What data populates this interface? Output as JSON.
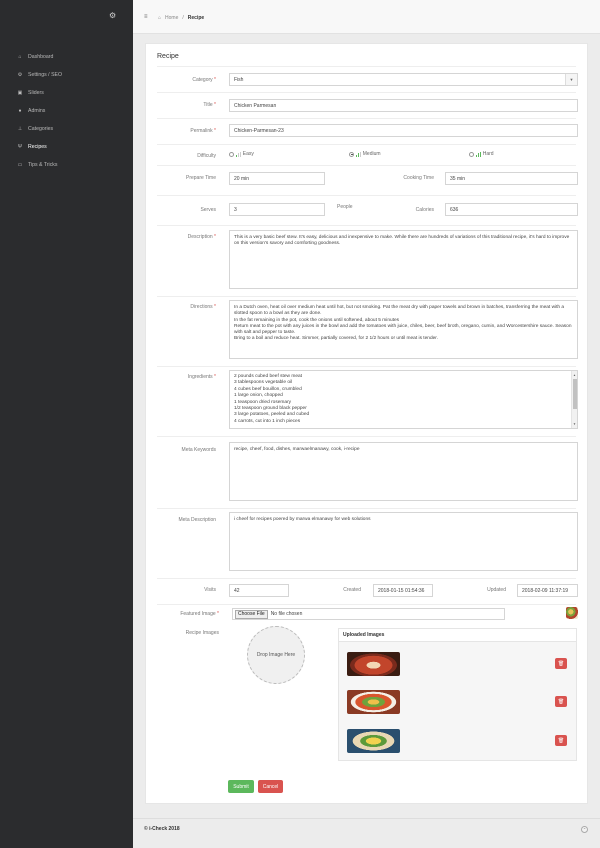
{
  "sidebar": {
    "items": [
      {
        "label": "Dashboard",
        "icon": "home-icon",
        "glyph": "⌂"
      },
      {
        "label": "Settings / SEO",
        "icon": "cogs-icon",
        "glyph": "⚙"
      },
      {
        "label": "Sliders",
        "icon": "image-icon",
        "glyph": "▣"
      },
      {
        "label": "Admins",
        "icon": "user-icon",
        "glyph": "●"
      },
      {
        "label": "Categories",
        "icon": "sitemap-icon",
        "glyph": "⊥"
      },
      {
        "label": "Recipes",
        "icon": "cutlery-icon",
        "glyph": "Ψ"
      },
      {
        "label": "Tips & Tricks",
        "icon": "card-icon",
        "glyph": "▭"
      }
    ]
  },
  "header": {
    "menu_glyph": "≡",
    "home_label": "Home",
    "separator": "/",
    "current": "Recipe"
  },
  "form": {
    "title": "Recipe",
    "labels": {
      "category": "Category",
      "title": "Title",
      "permalink": "Permalink",
      "difficulty": "Difficulty",
      "prepare_time": "Prepare Time",
      "cooking_time": "Cooking Time",
      "serves": "Serves",
      "people": "People",
      "calories": "Calories",
      "description": "Description",
      "directions": "Directions",
      "ingredients": "Ingredients",
      "meta_keywords": "Meta Keywords",
      "meta_description": "Meta Description",
      "visits": "Visits",
      "created": "Created",
      "updated": "Updated",
      "featured_image": "Featured Image",
      "recipe_images": "Recipe Images"
    },
    "required_mark": "*",
    "category": "Fish",
    "title_value": "Chicken Parmesan",
    "permalink": "Chicken-Parmesan-23",
    "difficulty": {
      "options": [
        "Easy",
        "Medium",
        "Hard"
      ],
      "selected": "Medium"
    },
    "prepare_time": "20 min",
    "cooking_time": "35 min",
    "serves": "3",
    "calories": "636",
    "description": "This is a very basic beef stew. It's easy, delicious and inexpensive to make. While there are hundreds of variations of this traditional recipe, it's hard to improve on this version's savory and comforting goodness.",
    "directions": [
      "In a Dutch oven, heat oil over medium heat until hot, but not smoking. Pat the meat dry with paper towels and brown in batches, transferring the meat with a slotted spoon to a bowl as they are done.",
      "In the fat remaining in the pot, cook the onions until softened, about 5 minutes",
      "Return meat to the pot with any juices in the bowl and add the tomatoes with juice, chiles, beer, beef broth, oregano, cumin, and Worcestershire sauce. Season with salt and pepper to taste.",
      "Bring to a boil and reduce heat. Simmer, partially covered, for 2 1/2 hours or until meat is tender."
    ],
    "ingredients": [
      "2 pounds cubed beef stew meat",
      "3 tablespoons vegetable oil",
      "4 cubes beef bouillon, crumbled",
      "1 large onion, chopped",
      "1 teaspoon dried rosemary",
      "1/2 teaspoon ground black pepper",
      "3 large potatoes, peeled and cubed",
      "4 carrots, cut into 1 inch pieces"
    ],
    "meta_keywords": "recipe, cheef, food, dishes, marwaelmanawy, cook, i-recipe",
    "meta_description": "i cheef for recipes poered by marwa elmanawy for web solutions",
    "visits": "42",
    "created": "2018-01-15 01:54:36",
    "updated": "2018-02-09 11:37:19",
    "file": {
      "button": "Choose File",
      "status": "No file chosen"
    },
    "dropzone": "Drop Image Here",
    "uploaded_title": "Uploaded Images",
    "submit": "Submit",
    "cancel": "Cancel"
  },
  "footer": {
    "text": "© i-Check 2018",
    "up_glyph": "⌃"
  },
  "colors": {
    "sidebar": "#2b2c2e",
    "submit": "#5cb85c",
    "cancel": "#d9534f",
    "delete": "#d9534f"
  }
}
